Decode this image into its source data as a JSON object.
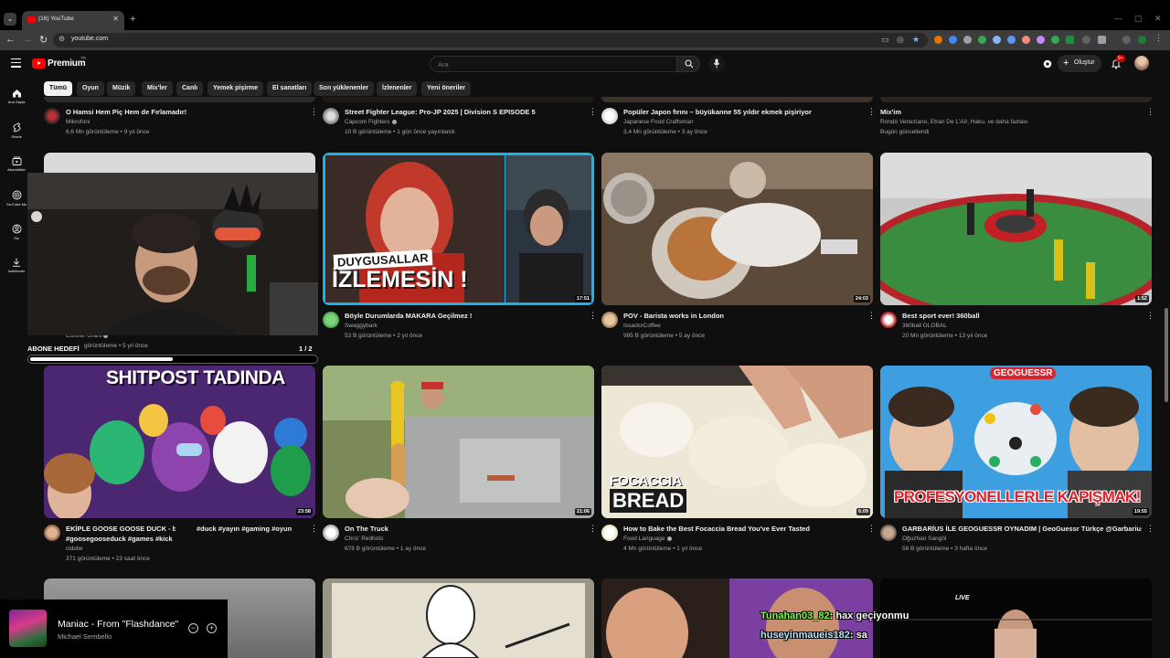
{
  "browser": {
    "tab_title": "(16) YouTube",
    "url": "youtube.com"
  },
  "header": {
    "logo_text": "Premium",
    "country_code": "TR",
    "search_placeholder": "Ara",
    "create_label": "Oluştur",
    "notification_count": "9+"
  },
  "sidebar": {
    "items": [
      {
        "label": "Ana Sayfa",
        "icon": "home-icon"
      },
      {
        "label": "Shorts",
        "icon": "shorts-icon"
      },
      {
        "label": "Abonelikler",
        "icon": "subscriptions-icon"
      },
      {
        "label": "YouTube Mu",
        "icon": "youtube-music-icon"
      },
      {
        "label": "Siz",
        "icon": "you-icon"
      },
      {
        "label": "İndirilenler",
        "icon": "download-icon"
      }
    ]
  },
  "chips": [
    "Tümü",
    "Oyun",
    "Müzik",
    "Mix'ler",
    "Canlı",
    "Yemek pişirme",
    "El sanatları",
    "Son yüklenenler",
    "İzlenenler",
    "Yeni öneriler"
  ],
  "videos": [
    {
      "title": "O Hamsi Hem Piç Hem de Fırlamadır!",
      "title2": "",
      "channel": "Mikrofoni",
      "verified": false,
      "meta": "6,6 Mn görüntüleme • 9 yıl önce",
      "duration": ""
    },
    {
      "title": "Street Fighter League: Pro-JP 2025 | Division S EPISODE 5",
      "title2": "",
      "channel": "Capcom Fighters",
      "verified": true,
      "meta": "10 B görüntüleme • 1 gün önce yayınlandı",
      "duration": ""
    },
    {
      "title": "Popüler Japon fırını – büyükanne 55 yıldır ekmek pişiriyor",
      "title2": "",
      "channel": "Japanese Food Craftsman",
      "verified": false,
      "meta": "3,4 Mn görüntüleme • 3 ay önce",
      "duration": ""
    },
    {
      "title": "Mix'im",
      "title2": "",
      "channel": "Rondò Veneziano, Etran De L'Aïr, Haku. ve daha fazlası",
      "verified": false,
      "meta": "Bugün güncellendi",
      "duration": ""
    },
    {
      "title": "",
      "title2": "",
      "channel": "Conner Grant",
      "verified": true,
      "meta": "görüntüleme • 5 yıl önce",
      "duration": ""
    },
    {
      "title": "Böyle Durumlarda MAKARA Geçilmez !",
      "title2": "",
      "channel": "Swaggybark",
      "verified": false,
      "meta": "53 B görüntüleme • 2 yıl önce",
      "duration": "17:51",
      "thumb_text_1": "DUYGUSALLAR",
      "thumb_text_2": "İZLEMESİN !"
    },
    {
      "title": "POV - Barista works in London",
      "title2": "",
      "channel": "IssackxCoffee",
      "verified": false,
      "meta": "995 B görüntüleme • 5 ay önce",
      "duration": "24:03"
    },
    {
      "title": "Best sport ever! 360ball",
      "title2": "",
      "channel": "360ball GLOBAL",
      "verified": false,
      "meta": "20 Mn görüntüleme • 13 yıl önce",
      "duration": "1:52"
    },
    {
      "title": "EKİPLE GOOSE GOOSE DUCK -  b2",
      "title_tags": "#duck #yayın #gaming #oyun",
      "title2": "#goosegooseduck  #games #kick",
      "channel": "cidotw",
      "verified": false,
      "meta": "371 görüntüleme • 23 saat önce",
      "duration": "23:58",
      "thumb_text": "SHITPOST TADINDA"
    },
    {
      "title": "On The Truck",
      "title2": "",
      "channel": "Chris' Redhots",
      "verified": false,
      "meta": "678 B görüntüleme • 1 ay önce",
      "duration": "21:06"
    },
    {
      "title": "How to Bake the Best Focaccia Bread You've Ever Tasted",
      "title2": "",
      "channel": "Food Language",
      "verified": true,
      "meta": "4 Mn görüntüleme • 1 yıl önce",
      "duration": "6:09",
      "thumb_text_1": "FOCACCIA",
      "thumb_text_2": "BREAD"
    },
    {
      "title": "GARBARİUS İLE GEOGUESSR OYNADIM | GeoGuessr Türkçe @Garbarius",
      "title2": "",
      "channel": "Oğuzhan Sangöl",
      "verified": false,
      "meta": "56 B görüntüleme • 3 hafta önce",
      "duration": "19:55",
      "thumb_text_1": "GEOGUESSR",
      "thumb_text_2": "PROFESYONELLERLE KAPIŞMAK!"
    }
  ],
  "bottom_row": {
    "live_badge": "LIVE"
  },
  "overlay": {
    "goal_label": "ABONE HEDEFİ",
    "goal_count": "1 / 2",
    "goal_progress": 0.5,
    "song": "Maniac - From \"Flashdance\"",
    "artist": "Michael Sembello",
    "chat": [
      {
        "user": "Tunahan03_82",
        "message": "hax geçiyonmu",
        "color": "#7cff4a"
      },
      {
        "user": "huseyinmaueis182",
        "message": "sa",
        "color": "#b9e6ff"
      }
    ]
  },
  "colors": {
    "brand": "#ff0000",
    "background": "#0f0f0f",
    "chip": "#272727"
  }
}
